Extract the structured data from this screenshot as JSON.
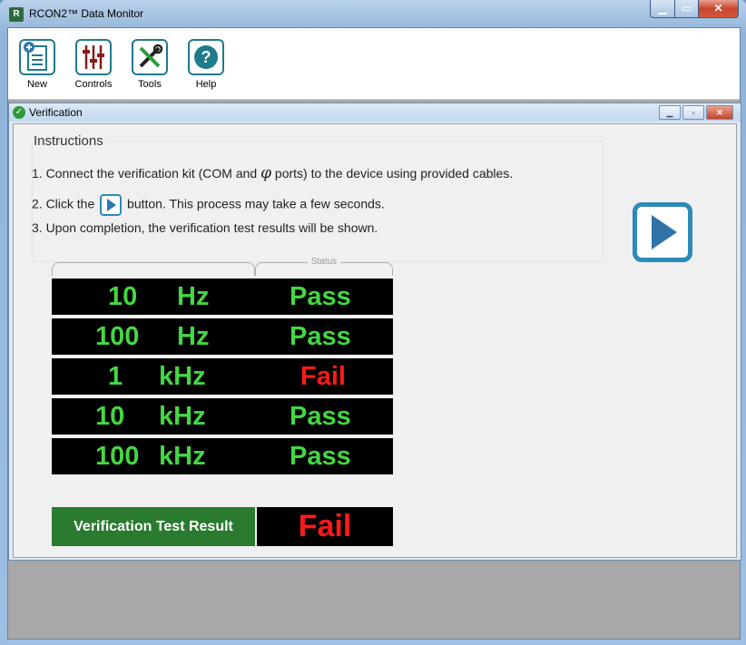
{
  "app": {
    "title": "RCON2™ Data Monitor",
    "icon_letter": "R"
  },
  "window_buttons": {
    "minimize": "▁",
    "maximize": "▭",
    "close": "✕"
  },
  "toolbar": {
    "items": [
      {
        "label": "New",
        "icon": "new-document-icon"
      },
      {
        "label": "Controls",
        "icon": "sliders-icon"
      },
      {
        "label": "Tools",
        "icon": "tools-icon"
      },
      {
        "label": "Help",
        "icon": "help-icon"
      }
    ],
    "help_glyph": "?"
  },
  "child_window": {
    "title": "Verification",
    "check_glyph": "✓",
    "buttons": {
      "minimize": "▁",
      "maximize": "▫",
      "close": "✕"
    }
  },
  "instructions": {
    "heading": "Instructions",
    "line1_pre": "1. Connect the verification kit (COM and",
    "line1_phi": "φ",
    "line1_post": "ports) to the device using provided cables.",
    "line2_pre": "2. Click the",
    "line2_post": "button. This process may take a few seconds.",
    "line3": "3. Upon completion, the verification test results will be shown."
  },
  "table": {
    "status_header": "Status",
    "rows": [
      {
        "value": "10",
        "unit": "Hz",
        "status": "Pass"
      },
      {
        "value": "100",
        "unit": "Hz",
        "status": "Pass"
      },
      {
        "value": "1",
        "unit": "kHz",
        "status": "Fail"
      },
      {
        "value": "10",
        "unit": "kHz",
        "status": "Pass"
      },
      {
        "value": "100",
        "unit": "kHz",
        "status": "Pass"
      }
    ]
  },
  "result": {
    "label": "Verification Test Result",
    "value": "Fail"
  },
  "colors": {
    "pass": "#43d743",
    "fail": "#ff1a1a",
    "accent": "#2e8ab8",
    "result_label_bg": "#2a7a30"
  }
}
